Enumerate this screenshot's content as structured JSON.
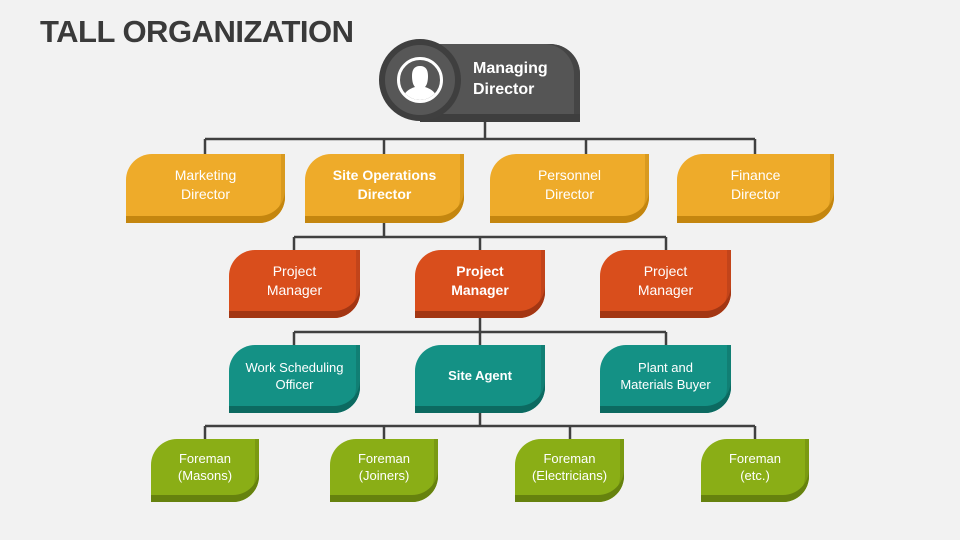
{
  "title": "TALL ORGANIZATION",
  "colors": {
    "background": "#f2f2f2",
    "connector": "#404040",
    "level0": "#555555",
    "level1": "#eeab2a",
    "level2": "#d94e1c",
    "level3": "#149185",
    "level4": "#8aae16"
  },
  "top": {
    "icon": "person-avatar-icon",
    "line1": "Managing",
    "line2": "Director"
  },
  "level1": [
    {
      "line1": "Marketing",
      "line2": "Director",
      "bold": false
    },
    {
      "line1": "Site Operations",
      "line2": "Director",
      "bold": true
    },
    {
      "line1": "Personnel",
      "line2": "Director",
      "bold": false
    },
    {
      "line1": "Finance",
      "line2": "Director",
      "bold": false
    }
  ],
  "level2": [
    {
      "line1": "Project",
      "line2": "Manager",
      "bold": false
    },
    {
      "line1": "Project",
      "line2": "Manager",
      "bold": true
    },
    {
      "line1": "Project",
      "line2": "Manager",
      "bold": false
    }
  ],
  "level3": [
    {
      "line1": "Work Scheduling",
      "line2": "Officer",
      "bold": false
    },
    {
      "line1": "Site Agent",
      "line2": "",
      "bold": true
    },
    {
      "line1": "Plant and",
      "line2": "Materials Buyer",
      "bold": false
    }
  ],
  "level4": [
    {
      "line1": "Foreman",
      "line2": "(Masons)"
    },
    {
      "line1": "Foreman",
      "line2": "(Joiners)"
    },
    {
      "line1": "Foreman",
      "line2": "(Electricians)"
    },
    {
      "line1": "Foreman",
      "line2": "(etc.)"
    }
  ]
}
